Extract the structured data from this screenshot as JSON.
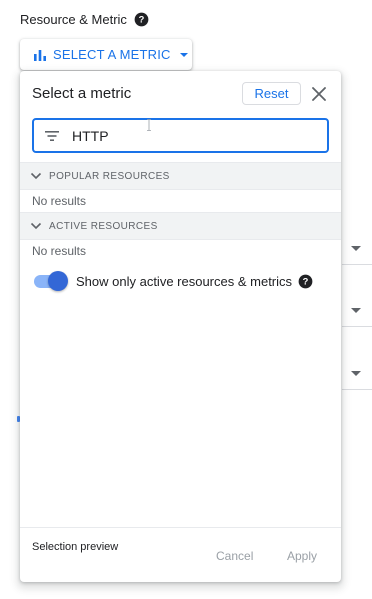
{
  "field": {
    "label": "Resource & Metric",
    "help_icon": "help-circle-icon"
  },
  "select_button": {
    "label": "SELECT A METRIC",
    "icon": "bar-chart-icon",
    "caret": "caret-down-icon"
  },
  "dialog": {
    "title": "Select a metric",
    "reset_label": "Reset",
    "close_icon": "close-icon",
    "search": {
      "value": "HTTP",
      "icon": "filter-icon"
    },
    "sections": [
      {
        "label": "POPULAR RESOURCES",
        "empty_text": "No results",
        "expanded": true
      },
      {
        "label": "ACTIVE RESOURCES",
        "empty_text": "No results",
        "expanded": true
      }
    ],
    "toggle": {
      "label": "Show only active resources & metrics",
      "checked": true,
      "help_icon": "help-circle-icon"
    },
    "footer": {
      "preview_label": "Selection preview",
      "cancel_label": "Cancel",
      "apply_label": "Apply"
    }
  },
  "colors": {
    "accent": "#1a73e8",
    "toggle_thumb": "#3367d6",
    "toggle_track": "#8ab4f8",
    "section_bg": "#f1f3f4",
    "disabled_text": "#9aa0a6"
  }
}
